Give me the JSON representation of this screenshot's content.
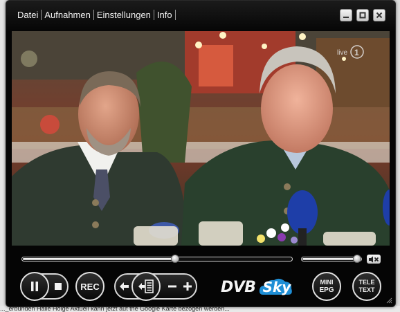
{
  "menu": {
    "items": [
      {
        "label": "Datei"
      },
      {
        "label": "Aufnahmen"
      },
      {
        "label": "Einstellungen"
      },
      {
        "label": "Info"
      }
    ]
  },
  "window_buttons": [
    "minimize-icon",
    "maximize-icon",
    "close-icon"
  ],
  "video": {
    "channel_logo": "live",
    "channel_number": "1"
  },
  "playback": {
    "progress_fraction": 0.57,
    "volume_fraction": 0.94
  },
  "controls": {
    "rec_label": "REC",
    "mini_epg_line1": "MINI",
    "mini_epg_line2": "EPG",
    "teletext_line1": "TELE",
    "teletext_line2": "TEXT"
  },
  "brand": {
    "name_part1": "DVB",
    "name_part2": "Sky",
    "accent_color": "#1f8fd6"
  },
  "background_page": {
    "text": "..._erbunden Halle Holge Aktuell kann jetzt aut the Google Karte bezogen werden..."
  },
  "colors": {
    "window_bg": "#050505",
    "control_text": "#f0f0f0",
    "sky_blue": "#1f8fd6"
  }
}
